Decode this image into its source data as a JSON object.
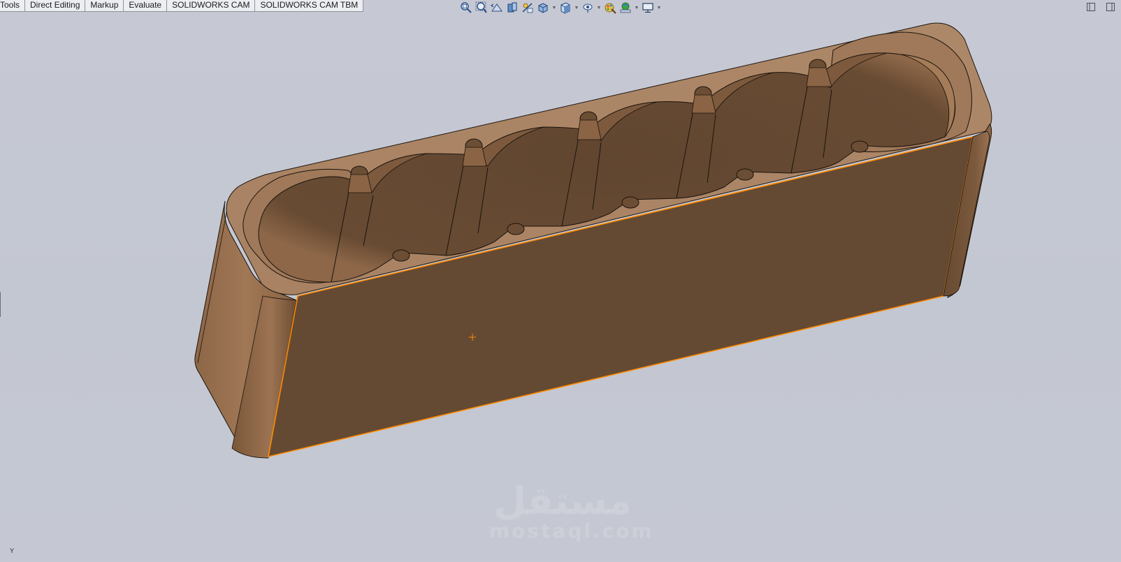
{
  "command_tabs": [
    "Tools",
    "Direct Editing",
    "Markup",
    "Evaluate",
    "SOLIDWORKS CAM",
    "SOLIDWORKS CAM TBM"
  ],
  "heads_up_toolbar": [
    {
      "icon": "zoom-to-fit-icon",
      "dropdown": false
    },
    {
      "icon": "zoom-to-area-icon",
      "dropdown": false
    },
    {
      "icon": "previous-view-icon",
      "dropdown": false
    },
    {
      "icon": "section-view-icon",
      "dropdown": false
    },
    {
      "icon": "dynamic-annotation-view-icon",
      "dropdown": false
    },
    {
      "icon": "view-orientation-icon",
      "dropdown": true
    },
    {
      "icon": "display-style-icon",
      "dropdown": true
    },
    {
      "icon": "hide-show-items-icon",
      "dropdown": true
    },
    {
      "icon": "edit-appearance-icon",
      "dropdown": false
    },
    {
      "icon": "apply-scene-icon",
      "dropdown": true
    },
    {
      "icon": "view-settings-icon",
      "dropdown": true
    }
  ],
  "triad_label": "Y",
  "watermark": {
    "arabic": "مستقل",
    "latin": "mostaql.com"
  },
  "colors": {
    "viewport_bg": "#c4c8d2",
    "wood_dark": "#654a33",
    "wood_light": "#a57f5d",
    "wood_mid": "#8a6444",
    "selection_edge": "#ff8a00"
  }
}
